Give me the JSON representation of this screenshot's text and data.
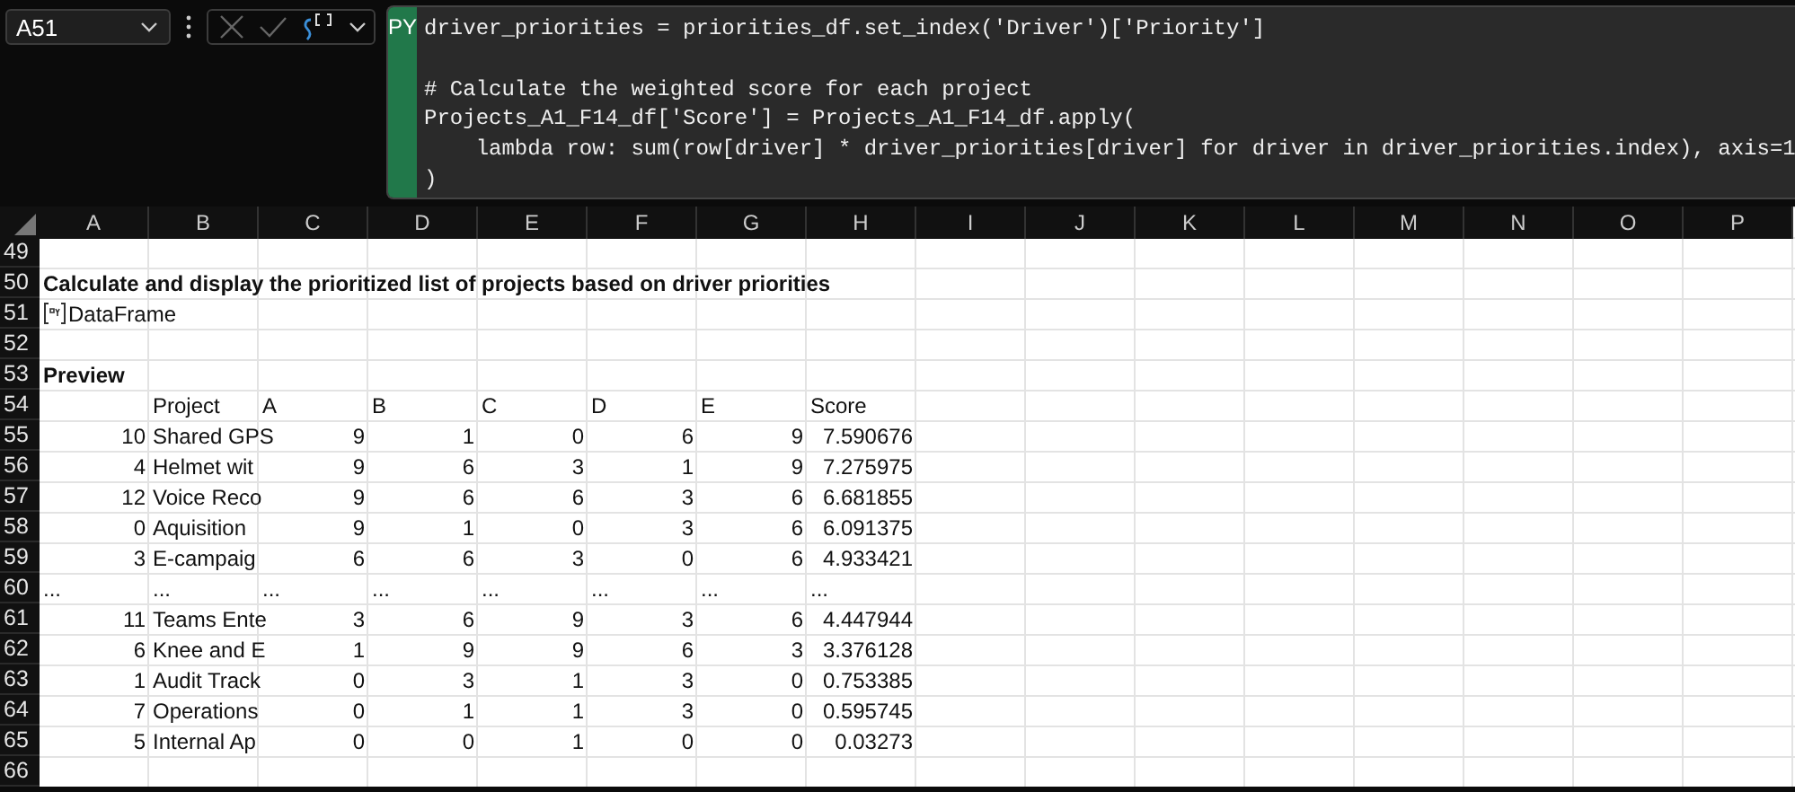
{
  "name_box": {
    "value": "A51"
  },
  "formula_bar": {
    "language_badge": "PY",
    "code_blocks": [
      [
        "driver_priorities = priorities_df.set_index('Driver')['Priority']"
      ],
      [
        "# Calculate the weighted score for each project",
        "Projects_A1_F14_df['Score'] = Projects_A1_F14_df.apply(",
        "    lambda row: sum(row[driver] * driver_priorities[driver] for driver in driver_priorities.index), axis=1",
        ")"
      ]
    ]
  },
  "columns": [
    "A",
    "B",
    "C",
    "D",
    "E",
    "F",
    "G",
    "H",
    "I",
    "J",
    "K",
    "L",
    "M",
    "N",
    "O",
    "P"
  ],
  "rows": [
    {
      "number": "49",
      "kind": "empty"
    },
    {
      "number": "50",
      "kind": "heading",
      "text": "Calculate and display the prioritized list of projects based on driver priorities"
    },
    {
      "number": "51",
      "kind": "object",
      "text": "DataFrame"
    },
    {
      "number": "52",
      "kind": "empty"
    },
    {
      "number": "53",
      "kind": "heading",
      "text": "Preview"
    },
    {
      "number": "54",
      "kind": "header",
      "cells": [
        "Project",
        "A",
        "B",
        "C",
        "D",
        "E",
        "Score"
      ]
    },
    {
      "number": "55",
      "kind": "data",
      "index": "10",
      "cells": [
        "Shared GPS",
        "9",
        "1",
        "0",
        "6",
        "9",
        "7.590676"
      ]
    },
    {
      "number": "56",
      "kind": "data",
      "index": "4",
      "cells": [
        "Helmet wit",
        "9",
        "6",
        "3",
        "1",
        "9",
        "7.275975"
      ]
    },
    {
      "number": "57",
      "kind": "data",
      "index": "12",
      "cells": [
        "Voice Reco",
        "9",
        "6",
        "6",
        "3",
        "6",
        "6.681855"
      ]
    },
    {
      "number": "58",
      "kind": "data",
      "index": "0",
      "cells": [
        "Aquisition",
        "9",
        "1",
        "0",
        "3",
        "6",
        "6.091375"
      ]
    },
    {
      "number": "59",
      "kind": "data",
      "index": "3",
      "cells": [
        "E-campaig",
        "6",
        "6",
        "3",
        "0",
        "6",
        "4.933421"
      ]
    },
    {
      "number": "60",
      "kind": "ellipsis",
      "cells": [
        "...",
        "...",
        "...",
        "...",
        "...",
        "...",
        "...",
        "..."
      ]
    },
    {
      "number": "61",
      "kind": "data",
      "index": "11",
      "cells": [
        "Teams Ente",
        "3",
        "6",
        "9",
        "3",
        "6",
        "4.447944"
      ]
    },
    {
      "number": "62",
      "kind": "data",
      "index": "6",
      "cells": [
        "Knee and E",
        "1",
        "9",
        "9",
        "6",
        "3",
        "3.376128"
      ]
    },
    {
      "number": "63",
      "kind": "data",
      "index": "1",
      "cells": [
        "Audit Track",
        "0",
        "3",
        "1",
        "3",
        "0",
        "0.753385"
      ]
    },
    {
      "number": "64",
      "kind": "data",
      "index": "7",
      "cells": [
        "Operations",
        "0",
        "1",
        "1",
        "3",
        "0",
        "0.595745"
      ]
    },
    {
      "number": "65",
      "kind": "data",
      "index": "5",
      "cells": [
        "Internal Ap",
        "0",
        "0",
        "1",
        "0",
        "0",
        "0.03273"
      ]
    },
    {
      "number": "66",
      "kind": "empty"
    }
  ]
}
